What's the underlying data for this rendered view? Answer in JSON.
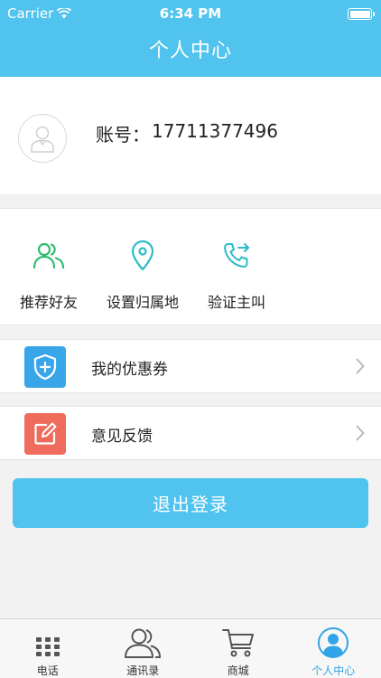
{
  "status_bar": {
    "carrier": "Carrier",
    "time": "6:34 PM"
  },
  "header": {
    "title": "个人中心"
  },
  "account": {
    "label": "账号：",
    "number": "17711377496"
  },
  "quick_actions": [
    {
      "label": "推荐好友",
      "icon": "friends-icon"
    },
    {
      "label": "设置归属地",
      "icon": "location-pin-icon"
    },
    {
      "label": "验证主叫",
      "icon": "phone-forward-icon"
    }
  ],
  "menu": [
    {
      "label": "我的优惠券",
      "icon": "shield-plus-icon",
      "color": "#3aa6ea"
    },
    {
      "label": "意见反馈",
      "icon": "edit-icon",
      "color": "#ef6b5c"
    }
  ],
  "logout_label": "退出登录",
  "tabs": [
    {
      "label": "电话",
      "icon": "dialpad-icon"
    },
    {
      "label": "通讯录",
      "icon": "contacts-icon"
    },
    {
      "label": "商城",
      "icon": "cart-icon"
    },
    {
      "label": "个人中心",
      "icon": "profile-icon",
      "active": true
    }
  ],
  "colors": {
    "primary": "#50c3ee",
    "green": "#2ebb6e",
    "teal": "#2cbbc9",
    "tab_active": "#2fa4e7",
    "coupon": "#3aa6ea",
    "feedback": "#ef6b5c"
  }
}
